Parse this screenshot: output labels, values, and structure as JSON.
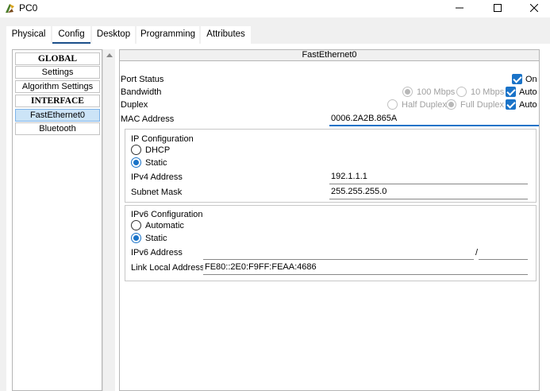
{
  "window": {
    "title": "PC0",
    "icon": "pc-icon"
  },
  "tabs": [
    {
      "label": "Physical"
    },
    {
      "label": "Config"
    },
    {
      "label": "Desktop"
    },
    {
      "label": "Programming"
    },
    {
      "label": "Attributes"
    }
  ],
  "sidebar": {
    "items": [
      {
        "label": "GLOBAL"
      },
      {
        "label": "Settings"
      },
      {
        "label": "Algorithm Settings"
      },
      {
        "label": "INTERFACE"
      },
      {
        "label": "FastEthernet0"
      },
      {
        "label": "Bluetooth"
      }
    ]
  },
  "panel": {
    "title": "FastEthernet0",
    "port_status": {
      "label": "Port Status",
      "option": "On",
      "checked": true
    },
    "bandwidth": {
      "label": "Bandwidth",
      "opt1": "100 Mbps",
      "opt2": "10 Mbps",
      "auto": "Auto"
    },
    "duplex": {
      "label": "Duplex",
      "opt1": "Half Duplex",
      "opt2": "Full Duplex",
      "auto": "Auto"
    },
    "mac": {
      "label": "MAC Address",
      "value": "0006.2A2B.865A"
    },
    "ip_config": {
      "title": "IP Configuration",
      "dhcp": "DHCP",
      "static": "Static",
      "ipv4_label": "IPv4 Address",
      "ipv4_value": "192.1.1.1",
      "mask_label": "Subnet Mask",
      "mask_value": "255.255.255.0"
    },
    "ipv6_config": {
      "title": "IPv6 Configuration",
      "automatic": "Automatic",
      "static": "Static",
      "ipv6_label": "IPv6 Address",
      "ipv6_value": "",
      "prefix_sep": "/",
      "prefix_value": "",
      "link_local_label": "Link Local Address:",
      "link_local_value": "FE80::2E0:F9FF:FEAA:4686"
    }
  },
  "colors": {
    "accent": "#1a73c8",
    "tab_underline": "#1b4f8a",
    "selected": "#cce4f7"
  }
}
